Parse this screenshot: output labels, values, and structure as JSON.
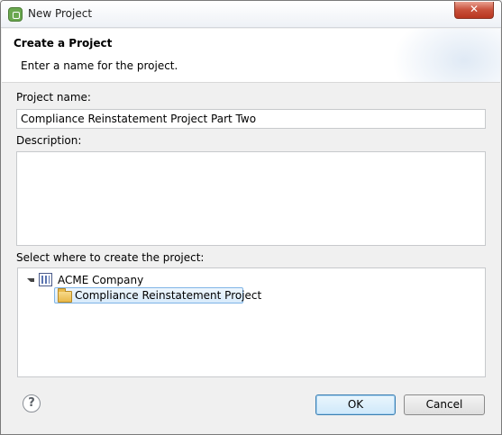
{
  "window": {
    "title": "New Project",
    "close_label": "✕"
  },
  "banner": {
    "title": "Create a Project",
    "message": "Enter a name for the project."
  },
  "form": {
    "project_name_label": "Project name:",
    "project_name_value": "Compliance Reinstatement Project Part Two",
    "description_label": "Description:",
    "description_value": "",
    "location_label": "Select where to create the project:"
  },
  "tree": {
    "items": [
      {
        "label": "ACME Company",
        "icon": "company-icon",
        "expanded": true,
        "level": 0
      },
      {
        "label": "Compliance Reinstatement Project",
        "icon": "folder-open-icon",
        "selected": true,
        "level": 1
      }
    ]
  },
  "footer": {
    "help_label": "?",
    "ok_label": "OK",
    "cancel_label": "Cancel"
  },
  "colors": {
    "close_button": "#c8503a",
    "selection_border": "#7fb4e6",
    "default_button_border": "#3c7fb1"
  }
}
